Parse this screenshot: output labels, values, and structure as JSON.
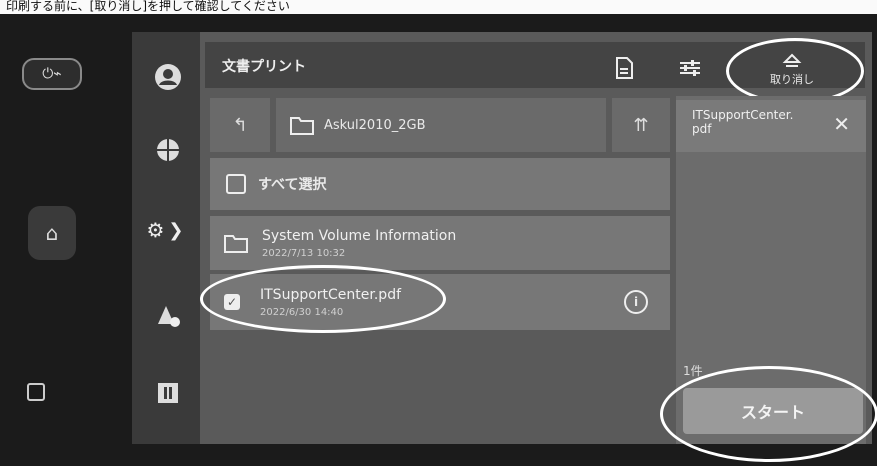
{
  "caption": "印刷する前に、[取り消し]を押して確認してください",
  "header": {
    "title": "文書プリント",
    "reset_label": "取り消し"
  },
  "path": {
    "folder_name": "Askul2010_2GB"
  },
  "select_all": {
    "label": "すべて選択"
  },
  "files": [
    {
      "name": "System Volume Information",
      "date": "2022/7/13 10:32"
    },
    {
      "name": "ITSupportCenter.pdf",
      "date": "2022/6/30 14:40"
    }
  ],
  "selected_file": {
    "name": "ITSupportCenter.\npdf"
  },
  "start": {
    "count": "1件",
    "label": "スタート"
  },
  "icons": [
    "power-icon",
    "home-icon",
    "nfc-icon",
    "user-icon",
    "globe-icon",
    "gear-icon",
    "chevron-right-icon",
    "apps-icon",
    "pause-icon",
    "document-icon",
    "settings-sliders-icon",
    "reset-icon",
    "back-arrow-icon",
    "folder-icon",
    "upload-icon",
    "check-icon",
    "info-icon",
    "close-icon"
  ]
}
